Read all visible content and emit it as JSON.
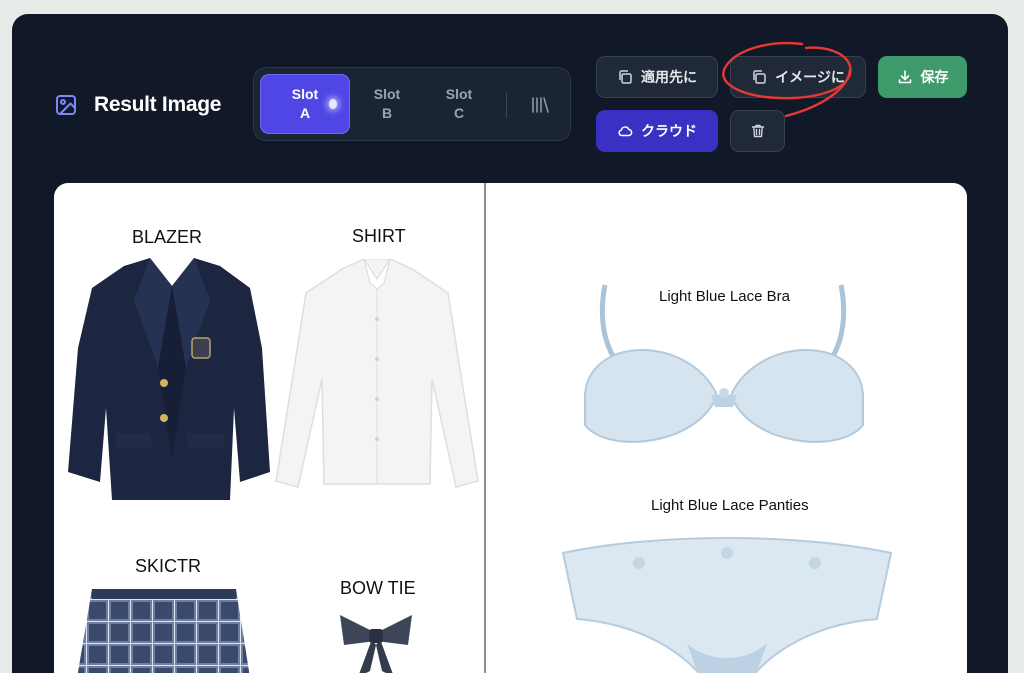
{
  "header": {
    "title": "Result Image",
    "title_icon": "image-icon"
  },
  "slots": [
    {
      "line1": "Slot",
      "line2": "A",
      "active": true
    },
    {
      "line1": "Slot",
      "line2": "B",
      "active": false
    },
    {
      "line1": "Slot",
      "line2": "C",
      "active": false
    }
  ],
  "toolbar": {
    "apply_label": "適用先に",
    "to_image_label": "イメージに",
    "save_label": "保存",
    "cloud_label": "クラウド"
  },
  "canvas": {
    "labels": {
      "blazer": "BLAZER",
      "shirt": "SHIRT",
      "skirt": "SKICTR",
      "bowtie": "BOW TIE",
      "bra": "Light Blue Lace Bra",
      "panties": "Light Blue Lace Panties"
    }
  },
  "colors": {
    "panel_bg": "#111827",
    "slot_active": "#4f46e5",
    "save_green": "#3e9a6a",
    "cloud_indigo": "#3b30c4",
    "annotation_red": "#e53935"
  }
}
